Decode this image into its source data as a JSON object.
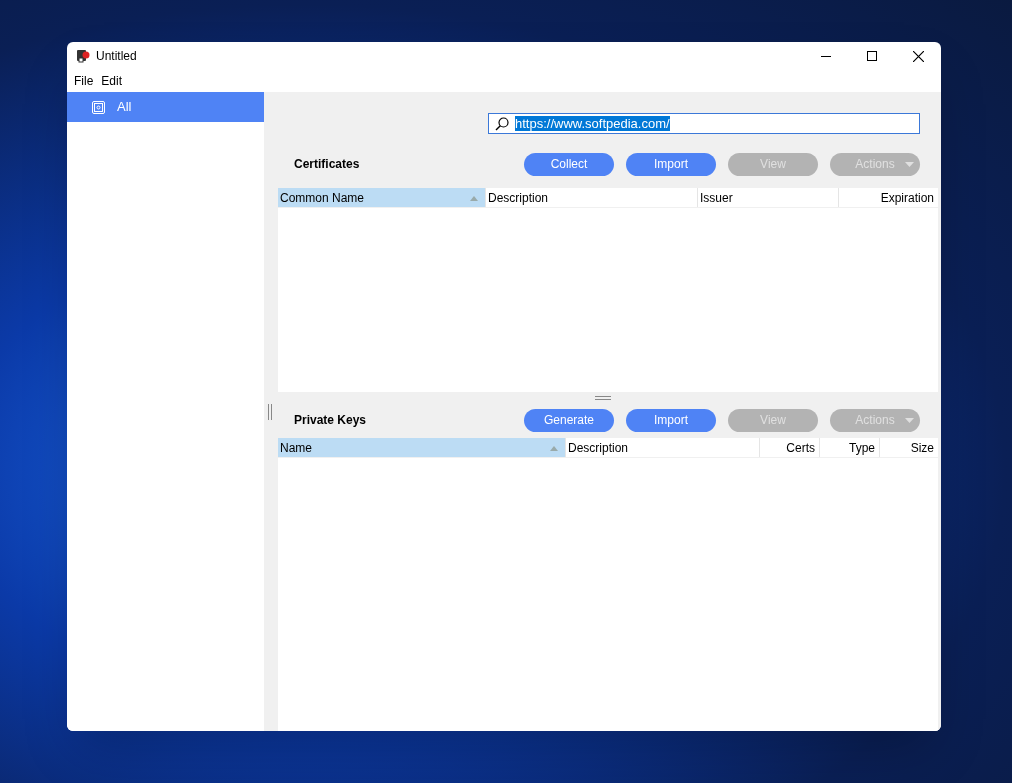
{
  "window": {
    "title": "Untitled"
  },
  "menu": [
    "File",
    "Edit"
  ],
  "sidebar": {
    "items": [
      {
        "label": "All",
        "selected": true
      }
    ]
  },
  "search": {
    "value": "https://www.softpedia.com/",
    "text_selected": true
  },
  "sections": [
    {
      "title": "Certificates",
      "buttons": [
        {
          "label": "Collect",
          "disabled": false,
          "dropdown": false
        },
        {
          "label": "Import",
          "disabled": false,
          "dropdown": false
        },
        {
          "label": "View",
          "disabled": true,
          "dropdown": false
        },
        {
          "label": "Actions",
          "disabled": true,
          "dropdown": true
        }
      ],
      "columns": [
        {
          "label": "Common Name",
          "selected": true,
          "kind": "text"
        },
        {
          "label": "Description",
          "selected": false,
          "kind": "text"
        },
        {
          "label": "Issuer",
          "selected": false,
          "kind": "text"
        },
        {
          "label": "Expiration",
          "selected": false,
          "kind": "numeric"
        }
      ]
    },
    {
      "title": "Private Keys",
      "buttons": [
        {
          "label": "Generate",
          "disabled": false,
          "dropdown": false
        },
        {
          "label": "Import",
          "disabled": false,
          "dropdown": false
        },
        {
          "label": "View",
          "disabled": true,
          "dropdown": false
        },
        {
          "label": "Actions",
          "disabled": true,
          "dropdown": true
        }
      ],
      "columns": [
        {
          "label": "Name",
          "selected": true,
          "kind": "text"
        },
        {
          "label": "Description",
          "selected": false,
          "kind": "text"
        },
        {
          "label": "Certs",
          "selected": false,
          "kind": "numeric"
        },
        {
          "label": "Type",
          "selected": false,
          "kind": "numeric"
        },
        {
          "label": "Size",
          "selected": false,
          "kind": "numeric"
        }
      ]
    }
  ]
}
